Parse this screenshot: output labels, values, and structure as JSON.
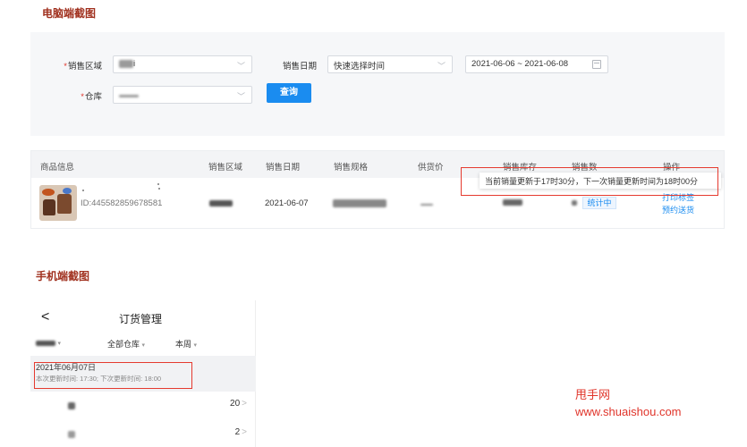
{
  "desktop_section_title": "电脑端截图",
  "mobile_section_title": "手机端截图",
  "filters": {
    "region_label": "销售区域",
    "region_value_suffix": "i",
    "warehouse_label": "仓库",
    "sale_date_label": "销售日期",
    "quick_time_placeholder": "快速选择时间",
    "date_range": "2021-06-06 ~ 2021-06-08",
    "query_button": "查询"
  },
  "table": {
    "headers": [
      "商品信息",
      "销售区域",
      "销售日期",
      "销售规格",
      "供货价",
      "销售库存",
      "销售数",
      "操作"
    ],
    "row": {
      "product_id": "ID:445582859678581",
      "sale_date": "2021-06-07",
      "status": "统计中",
      "actions": [
        "打印标签",
        "预约送货"
      ]
    },
    "tooltip": "当前销量更新于17时30分，下一次销量更新时间为18时00分"
  },
  "mobile": {
    "back_symbol": "<",
    "title": "订货管理",
    "filter_warehouse": "全部仓库",
    "filter_period": "本周",
    "date": "2021年06月07日",
    "update_info": "本次更新时间: 17:30; 下次更新时间: 18:00",
    "rows": [
      {
        "count": "20"
      },
      {
        "count": "2"
      }
    ]
  },
  "watermark": {
    "name": "甩手网",
    "url": "www.shuaishou.com"
  },
  "colors": {
    "accent": "#1a8cf0",
    "highlight_box": "#e53a2f",
    "section_title": "#a0301e"
  }
}
